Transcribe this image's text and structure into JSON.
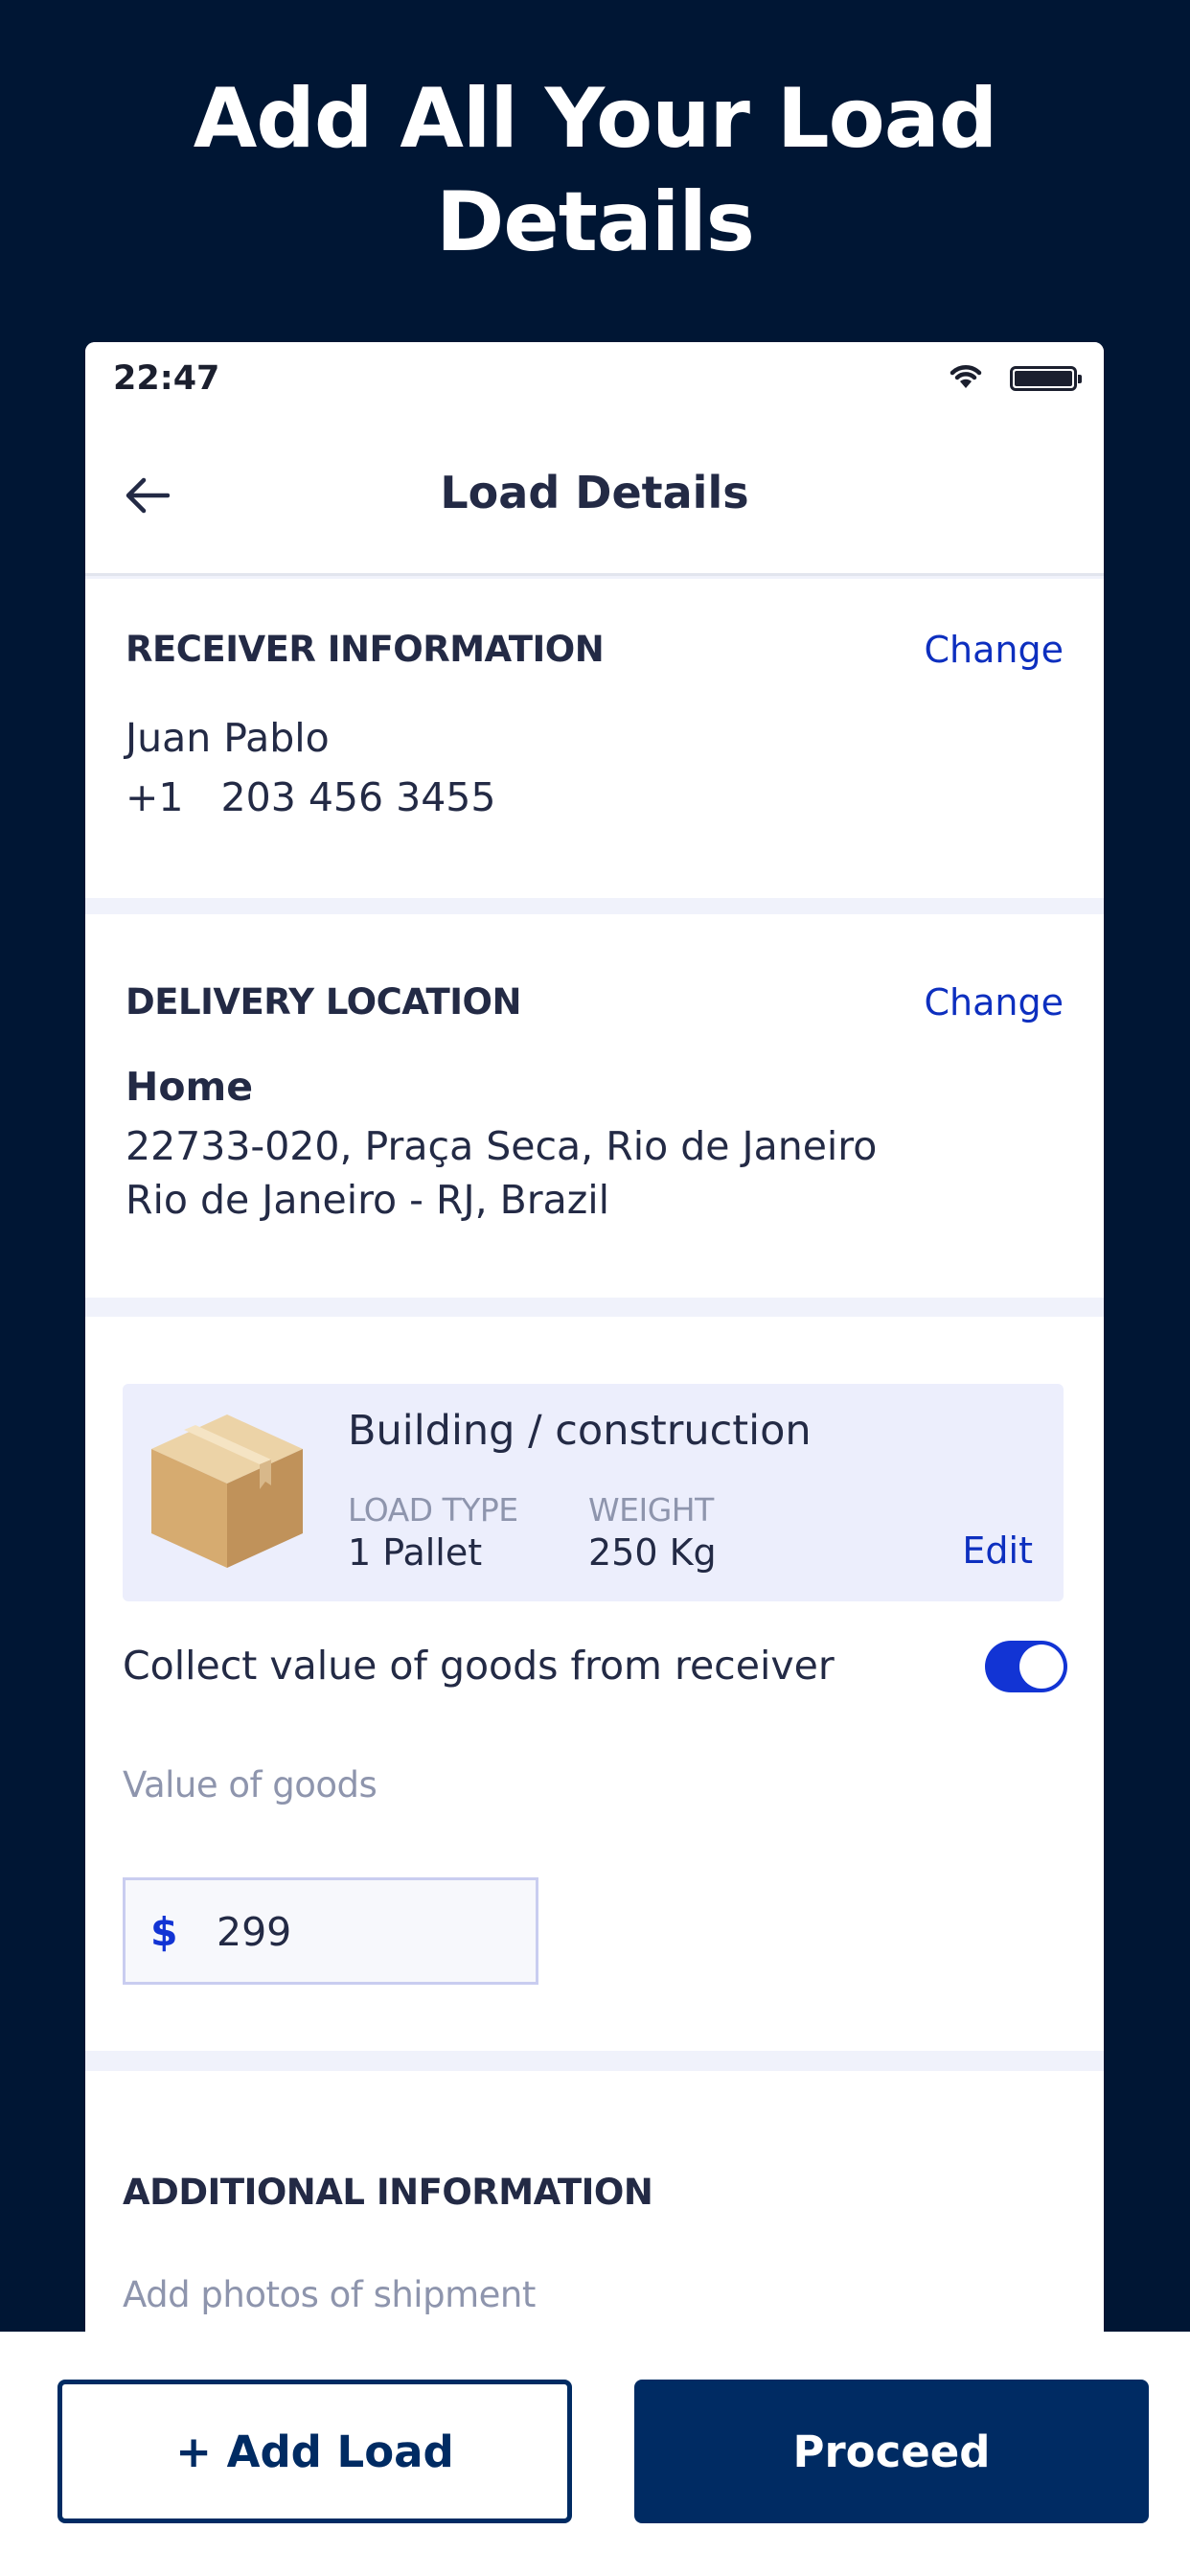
{
  "headline": {
    "line1": "Add All Your Load",
    "line2": "Details"
  },
  "status_bar": {
    "time": "22:47",
    "icons": [
      "wifi-icon",
      "battery-icon"
    ]
  },
  "nav": {
    "title": "Load Details",
    "back_icon": "arrow-left-icon"
  },
  "receiver": {
    "heading": "RECEIVER INFORMATION",
    "change_label": "Change",
    "name": "Juan Pablo",
    "phone": "+1   203 456 3455"
  },
  "delivery": {
    "heading": "DELIVERY LOCATION",
    "change_label": "Change",
    "place_name": "Home",
    "address_line1": "22733-020, Praça Seca, Rio de Janeiro",
    "address_line2": "Rio de Janeiro - RJ, Brazil"
  },
  "load": {
    "title": "Building / construction",
    "icon": "package-box-icon",
    "type_label": "LOAD TYPE",
    "type_value": "1 Pallet",
    "weight_label": "WEIGHT",
    "weight_value": "250 Kg",
    "edit_label": "Edit"
  },
  "collect": {
    "label": "Collect value of goods from receiver",
    "enabled": true
  },
  "value_of_goods": {
    "label": "Value of goods",
    "currency": "$",
    "value": "299"
  },
  "additional": {
    "heading": "ADDITIONAL INFORMATION",
    "photos_label": "Add photos of shipment"
  },
  "actions": {
    "add_load_label": "+ Add Load",
    "proceed_label": "Proceed"
  },
  "colors": {
    "background": "#001634",
    "primary": "#002b63",
    "accent": "#1234d4",
    "link": "#0d2fbf"
  }
}
